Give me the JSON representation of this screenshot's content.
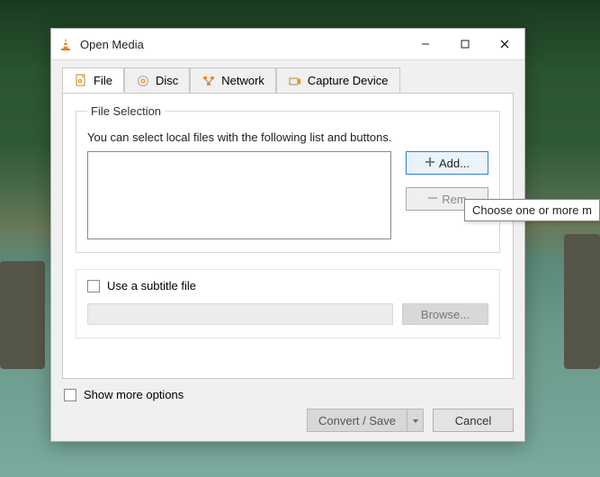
{
  "window": {
    "title": "Open Media"
  },
  "controls": {
    "minimize": "—",
    "maximize": "▢",
    "close": "✕"
  },
  "tabs": {
    "file": "File",
    "disc": "Disc",
    "network": "Network",
    "capture": "Capture Device"
  },
  "file_section": {
    "legend": "File Selection",
    "desc": "You can select local files with the following list and buttons.",
    "add": "Add...",
    "remove": "Rem"
  },
  "subtitle": {
    "label": "Use a subtitle file",
    "browse": "Browse..."
  },
  "more_options": "Show more options",
  "footer": {
    "convert": "Convert / Save",
    "cancel": "Cancel"
  },
  "tooltip": "Choose one or more m"
}
